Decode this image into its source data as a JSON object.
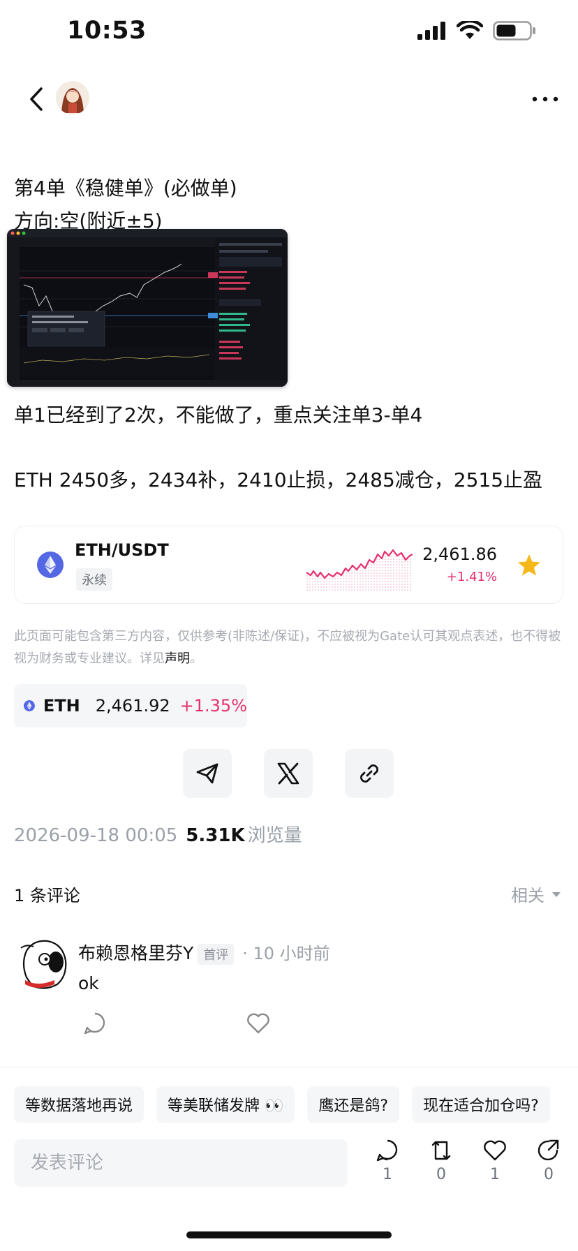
{
  "status_bar": {
    "time": "10:53"
  },
  "post": {
    "line1": "第4单《稳健单》(必做单)",
    "line2": "方向:空(附近±5)",
    "line3": "单1已经到了2次，不能做了，重点关注单3-单4",
    "line4": "ETH 2450多，2434补，2410止损，2485减仓，2515止盈"
  },
  "ticker_card": {
    "pair": "ETH/USDT",
    "tag": "永续",
    "price": "2,461.86",
    "change": "+1.41%",
    "change_color": "#e5306b",
    "favorite_color": "#f5b81a"
  },
  "disclaimer": {
    "text": "此页面可能包含第三方内容，仅供参考(非陈述/保证)，不应被视为Gate认可其观点表述，也不得被视为财务或专业建议。详见",
    "link": "声明",
    "end": "。"
  },
  "coin_chip": {
    "symbol": "ETH",
    "price": "2,461.92",
    "change": "+1.35%"
  },
  "share": [
    "send-icon",
    "x-icon",
    "link-icon"
  ],
  "meta": {
    "date": "2026-09-18 00:05",
    "views": "5.31K",
    "views_label": "浏览量"
  },
  "comments": {
    "count_label": "1 条评论",
    "sort_label": "相关",
    "items": [
      {
        "user": "布赖恩格里芬Y",
        "badge": "首评",
        "time": "· 10 小时前",
        "body": "ok"
      }
    ]
  },
  "suggestions": [
    "等数据落地再说",
    "等美联储发牌 👀",
    "鹰还是鸽?",
    "现在适合加仓吗?"
  ],
  "bottom_bar": {
    "input_placeholder": "发表评论",
    "comment_count": "1",
    "repost_count": "0",
    "like_count": "1",
    "share_count": "0"
  },
  "colors": {
    "accent_red": "#e5306b",
    "eth_blue": "#5468e4",
    "muted": "#9aa0a8"
  }
}
